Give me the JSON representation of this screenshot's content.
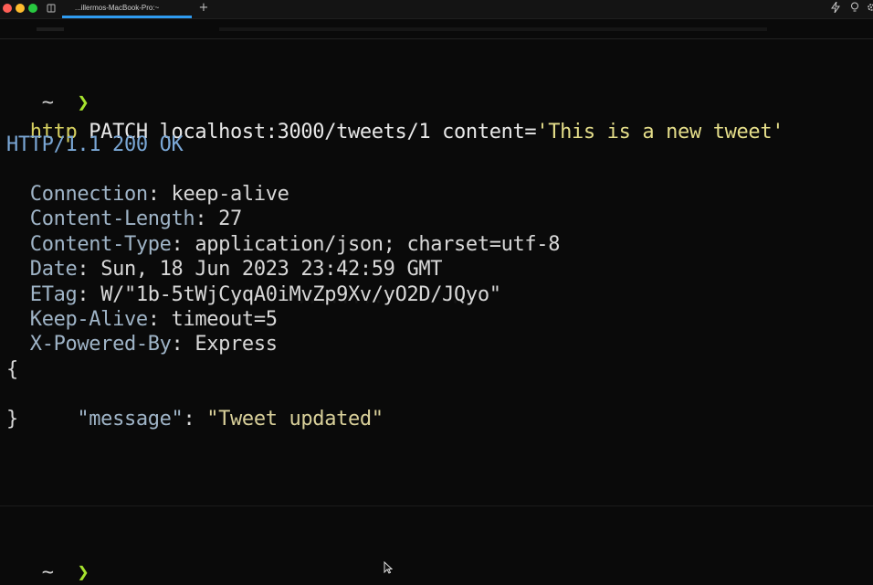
{
  "window": {
    "tab_title": "...illermos-MacBook-Pro:~",
    "new_tab": "+",
    "icons": [
      "book-icon",
      "bolt-icon",
      "bulb-icon",
      "gear-icon"
    ]
  },
  "terminal": {
    "prompt1": {
      "tilde": "~",
      "arrow": "❯"
    },
    "command": {
      "program": "http",
      "args": " PATCH localhost:3000/tweets/1 content=",
      "value": "'This is a new tweet'"
    },
    "status_line": "HTTP/1.1 200 OK",
    "headers": [
      {
        "key": "Connection",
        "value": "keep-alive"
      },
      {
        "key": "Content-Length",
        "value": "27"
      },
      {
        "key": "Content-Type",
        "value": "application/json; charset=utf-8"
      },
      {
        "key": "Date",
        "value": "Sun, 18 Jun 2023 23:42:59 GMT"
      },
      {
        "key": "ETag",
        "value": "W/\"1b-5tWjCyqA0iMvZp9Xv/yO2D/JQyo\""
      },
      {
        "key": "Keep-Alive",
        "value": "timeout=5"
      },
      {
        "key": "X-Powered-By",
        "value": "Express"
      }
    ],
    "body": {
      "open": "{",
      "key": "\"message\"",
      "value": "\"Tweet updated\"",
      "close": "}"
    },
    "prompt2": {
      "tilde": "~",
      "arrow": "❯"
    }
  },
  "colors": {
    "background": "#0a0a0a",
    "prompt_arrow": "#a6e22e",
    "command": "#d6d060",
    "status": "#7aa7d6",
    "tab_accent": "#2f9bf0"
  }
}
